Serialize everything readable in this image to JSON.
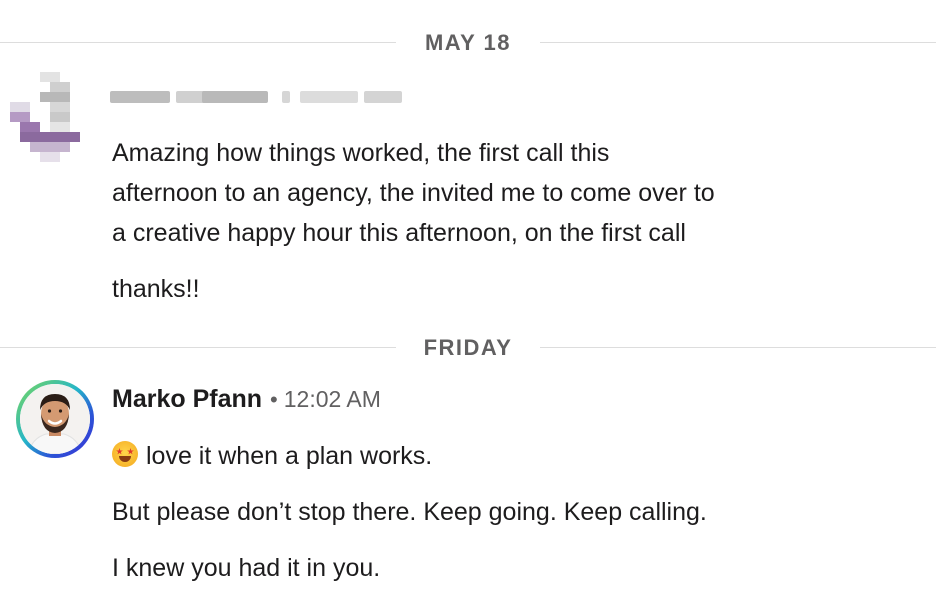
{
  "dividers": {
    "first": "MAY 18",
    "second": "FRIDAY"
  },
  "messages": [
    {
      "sender": "",
      "time": "",
      "lines": [
        "Amazing how things worked, the first call this",
        "afternoon to an agency, the invited me to come over to",
        "a creative happy hour this afternoon, on the first call"
      ],
      "followup": "thanks!!"
    },
    {
      "sender": "Marko Pfann",
      "separator": "•",
      "time": "12:02 AM",
      "lines": [
        "love it when a plan works.",
        "But please don’t stop there. Keep going. Keep calling.",
        "I knew you had it in you."
      ],
      "emoji": "star-struck-emoji"
    }
  ],
  "colors": {
    "text": "#1d1c1d",
    "muted": "#616061",
    "divider": "#dddddd",
    "avatar_ring": "#2b55d6"
  }
}
